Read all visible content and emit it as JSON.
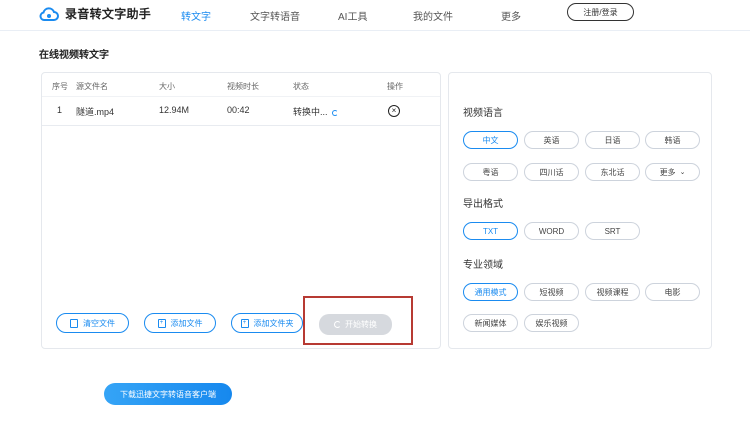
{
  "app": {
    "title": "录音转文字助手",
    "nav": [
      "转文字",
      "文字转语音",
      "AI工具",
      "我的文件",
      "更多"
    ],
    "login_label": "注册/登录"
  },
  "page_title": "在线视频转文字",
  "table": {
    "headers": {
      "index": "序号",
      "name": "源文件名",
      "size": "大小",
      "duration": "视频时长",
      "status": "状态",
      "op": "操作"
    },
    "row": {
      "index": "1",
      "name": "隧道.mp4",
      "size": "12.94M",
      "duration": "00:42",
      "status": "转换中..."
    }
  },
  "actions": {
    "clear": "清空文件",
    "add_file": "添加文件",
    "add_folder": "添加文件夹",
    "start": "开始转换"
  },
  "settings": {
    "language_title": "视频语言",
    "languages": [
      "中文",
      "英语",
      "日语",
      "韩语",
      "粤语",
      "四川话",
      "东北话",
      "更多"
    ],
    "format_title": "导出格式",
    "formats": [
      "TXT",
      "WORD",
      "SRT"
    ],
    "domain_title": "专业领域",
    "domains": [
      "通用模式",
      "短视频",
      "视频课程",
      "电影",
      "新闻媒体",
      "娱乐视频"
    ]
  },
  "download_label": "下载迅捷文字转语音客户端",
  "colors": {
    "accent": "#1a8bf0",
    "highlight": "#b73a33",
    "disabled": "#d6d9de"
  }
}
